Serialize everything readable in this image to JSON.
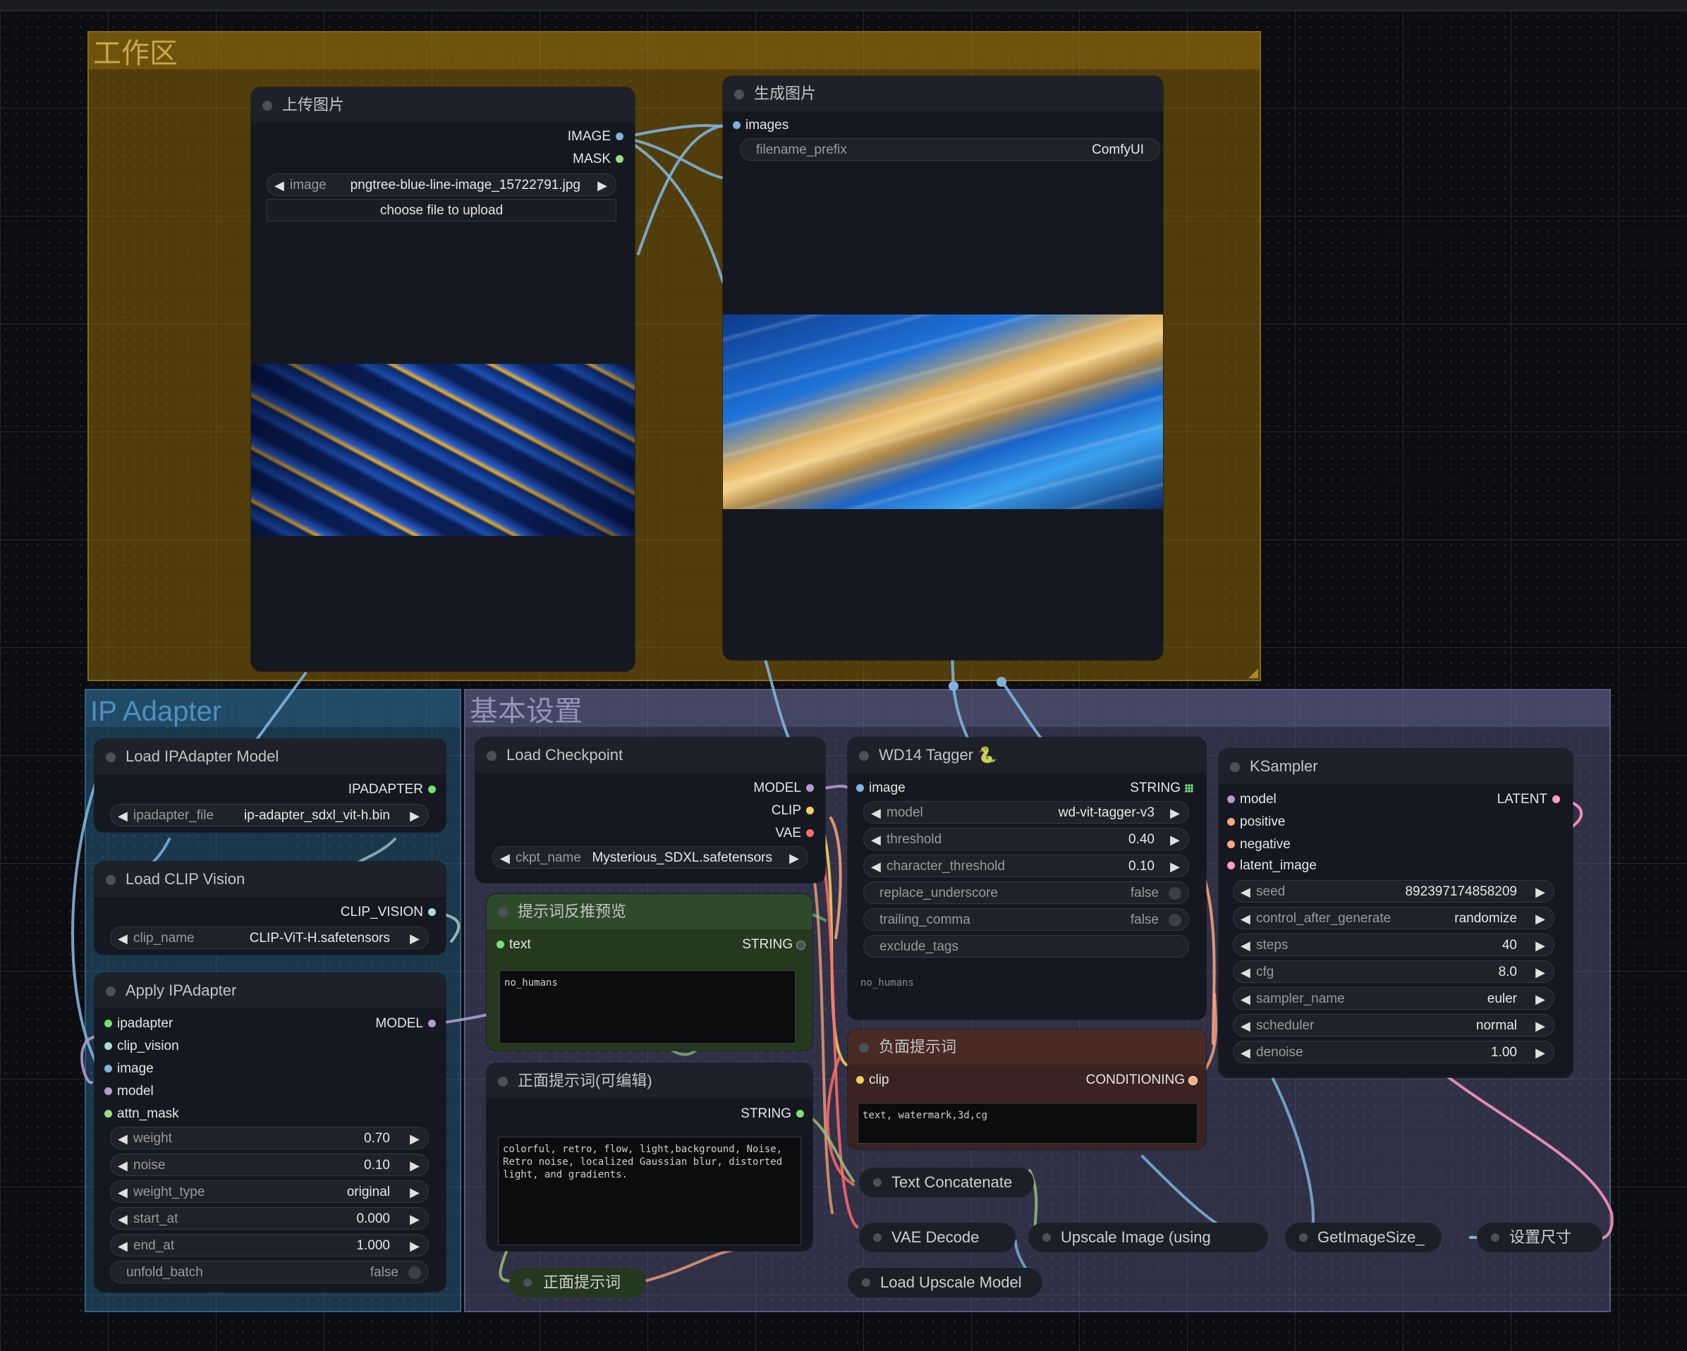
{
  "groups": {
    "workspace": "工作区",
    "ip_adapter": "IP Adapter",
    "basic": "基本设置"
  },
  "colors": {
    "IMAGE": "#7fb3dc",
    "MASK": "#9be07e",
    "MODEL": "#b49ad0",
    "CLIP": "#f2cf5a",
    "VAE": "#ff6b6b",
    "LATENT": "#ff9cc3",
    "CONDITIONING": "#ffa77b",
    "STRING": "#7dde7a",
    "CLIP_VISION": "#a8dadc",
    "IPADAPTER": "#6ee26e"
  },
  "upload": {
    "title": "上传图片",
    "out_image": "IMAGE",
    "out_mask": "MASK",
    "image_label": "image",
    "image_value": "pngtree-blue-line-image_15722791.jpg",
    "upload_button": "choose file to upload"
  },
  "save": {
    "title": "生成图片",
    "in_images": "images",
    "prefix_label": "filename_prefix",
    "prefix_value": "ComfyUI"
  },
  "ipa_loader": {
    "title": "Load IPAdapter Model",
    "out": "IPADAPTER",
    "file_label": "ipadapter_file",
    "file_value": "ip-adapter_sdxl_vit-h.bin"
  },
  "clip_vision": {
    "title": "Load CLIP Vision",
    "out": "CLIP_VISION",
    "name_label": "clip_name",
    "name_value": "CLIP-ViT-H.safetensors"
  },
  "apply_ipa": {
    "title": "Apply IPAdapter",
    "out": "MODEL",
    "in_ipadapter": "ipadapter",
    "in_clip_vision": "clip_vision",
    "in_image": "image",
    "in_model": "model",
    "in_attn_mask": "attn_mask",
    "weight_label": "weight",
    "weight_value": "0.70",
    "noise_label": "noise",
    "noise_value": "0.10",
    "weight_type_label": "weight_type",
    "weight_type_value": "original",
    "start_label": "start_at",
    "start_value": "0.000",
    "end_label": "end_at",
    "end_value": "1.000",
    "unfold_label": "unfold_batch",
    "unfold_value": "false"
  },
  "checkpoint": {
    "title": "Load Checkpoint",
    "out_model": "MODEL",
    "out_clip": "CLIP",
    "out_vae": "VAE",
    "ckpt_label": "ckpt_name",
    "ckpt_value": "Mysterious_SDXL.safetensors"
  },
  "preview_prompt": {
    "title": "提示词反推预览",
    "in_text": "text",
    "out": "STRING",
    "content": "no_humans"
  },
  "positive_editable": {
    "title": "正面提示词(可编辑)",
    "out": "STRING",
    "content": "colorful, retro, flow, light,background, Noise,\nRetro noise, localized Gaussian blur, distorted\nlight, and gradients."
  },
  "positive_collapsed": {
    "title": "正面提示词"
  },
  "tagger": {
    "title": "WD14 Tagger",
    "badge": "🐍",
    "in_image": "image",
    "out": "STRING",
    "model_label": "model",
    "model_value": "wd-vit-tagger-v3",
    "threshold_label": "threshold",
    "threshold_value": "0.40",
    "char_label": "character_threshold",
    "char_value": "0.10",
    "replace_label": "replace_underscore",
    "replace_value": "false",
    "trailing_label": "trailing_comma",
    "trailing_value": "false",
    "exclude_label": "exclude_tags",
    "result": "no_humans"
  },
  "negative": {
    "title": "负面提示词",
    "in_clip": "clip",
    "out": "CONDITIONING",
    "content": "text, watermark,3d,cg"
  },
  "ksampler": {
    "title": "KSampler",
    "in_model": "model",
    "in_positive": "positive",
    "in_negative": "negative",
    "in_latent": "latent_image",
    "out": "LATENT",
    "seed_label": "seed",
    "seed_value": "892397174858209",
    "cag_label": "control_after_generate",
    "cag_value": "randomize",
    "steps_label": "steps",
    "steps_value": "40",
    "cfg_label": "cfg",
    "cfg_value": "8.0",
    "sampler_label": "sampler_name",
    "sampler_value": "euler",
    "scheduler_label": "scheduler",
    "scheduler_value": "normal",
    "denoise_label": "denoise",
    "denoise_value": "1.00"
  },
  "collapsed": {
    "text_concat": "Text Concatenate",
    "vae_decode": "VAE Decode",
    "upscale_image": "Upscale Image (using",
    "get_image_size": "GetImageSize_",
    "set_size": "设置尺寸",
    "load_upscale": "Load Upscale Model"
  }
}
